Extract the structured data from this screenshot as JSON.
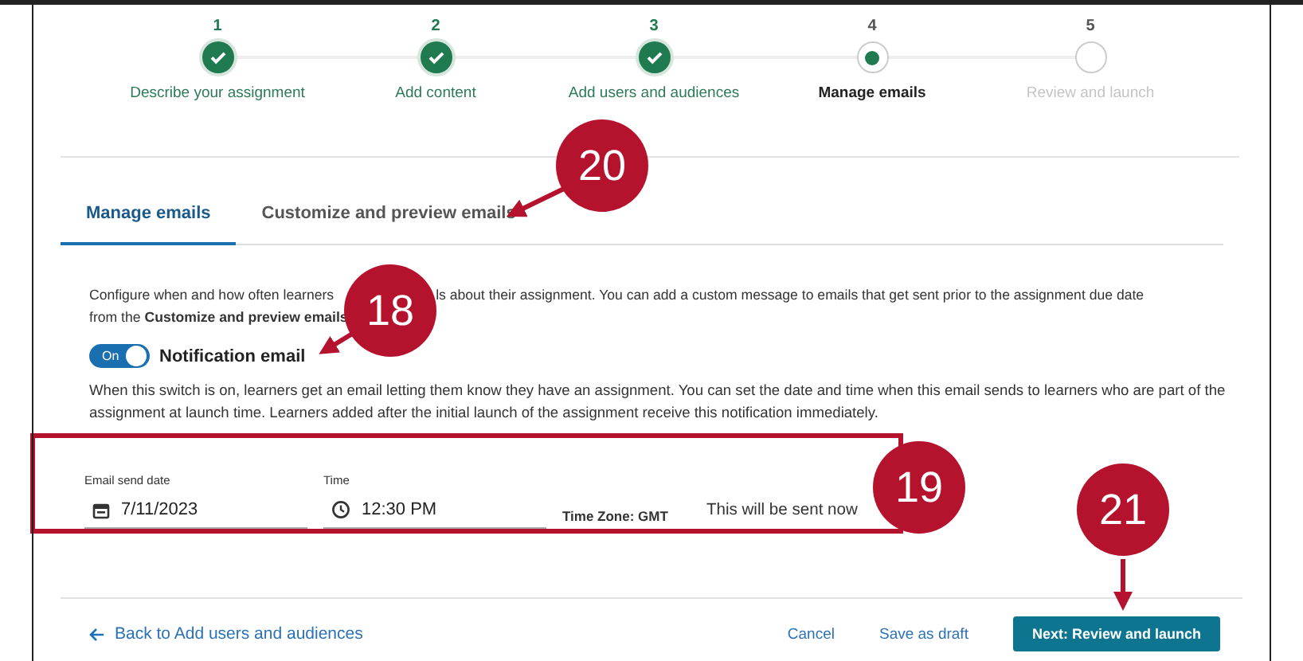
{
  "steps": [
    {
      "number": "1",
      "label": "Describe your assignment",
      "kind": "done"
    },
    {
      "number": "2",
      "label": "Add content",
      "kind": "done"
    },
    {
      "number": "3",
      "label": "Add users and audiences",
      "kind": "done"
    },
    {
      "number": "4",
      "label": "Manage emails",
      "kind": "current"
    },
    {
      "number": "5",
      "label": "Review and launch",
      "kind": "upcoming"
    }
  ],
  "tabs": [
    {
      "label": "Manage emails",
      "selected": true
    },
    {
      "label": "Customize and preview emails",
      "selected": false
    }
  ],
  "intro": {
    "line_1_start": "Configure when and how often learners",
    "line_1_end": "ls about their assignment. You can add a custom message to emails that get sent prior to the assignment due date",
    "line_2": "from the **Customize and preview emails**"
  },
  "notification": {
    "switch_label": "On",
    "on": true,
    "title": "Notification email",
    "description": "When this switch is on, learners get an email letting them know they have an assignment. You can set the date and time when this email sends to learners who are part of the assignment at launch time. Learners added after the initial launch of the assignment receive this notification immediately."
  },
  "date_field": {
    "label": "Email send date",
    "value": "7/11/2023"
  },
  "time_field": {
    "label": "Time",
    "value": "12:30 PM"
  },
  "time_zone": "Time Zone: GMT",
  "send_note": "This will be sent now",
  "footer": {
    "back_link": "Back to Add users and audiences",
    "cancel": "Cancel",
    "save_draft": "Save as draft",
    "next": "Next: Review and launch"
  },
  "callouts": [
    "18",
    "19",
    "20",
    "21"
  ]
}
